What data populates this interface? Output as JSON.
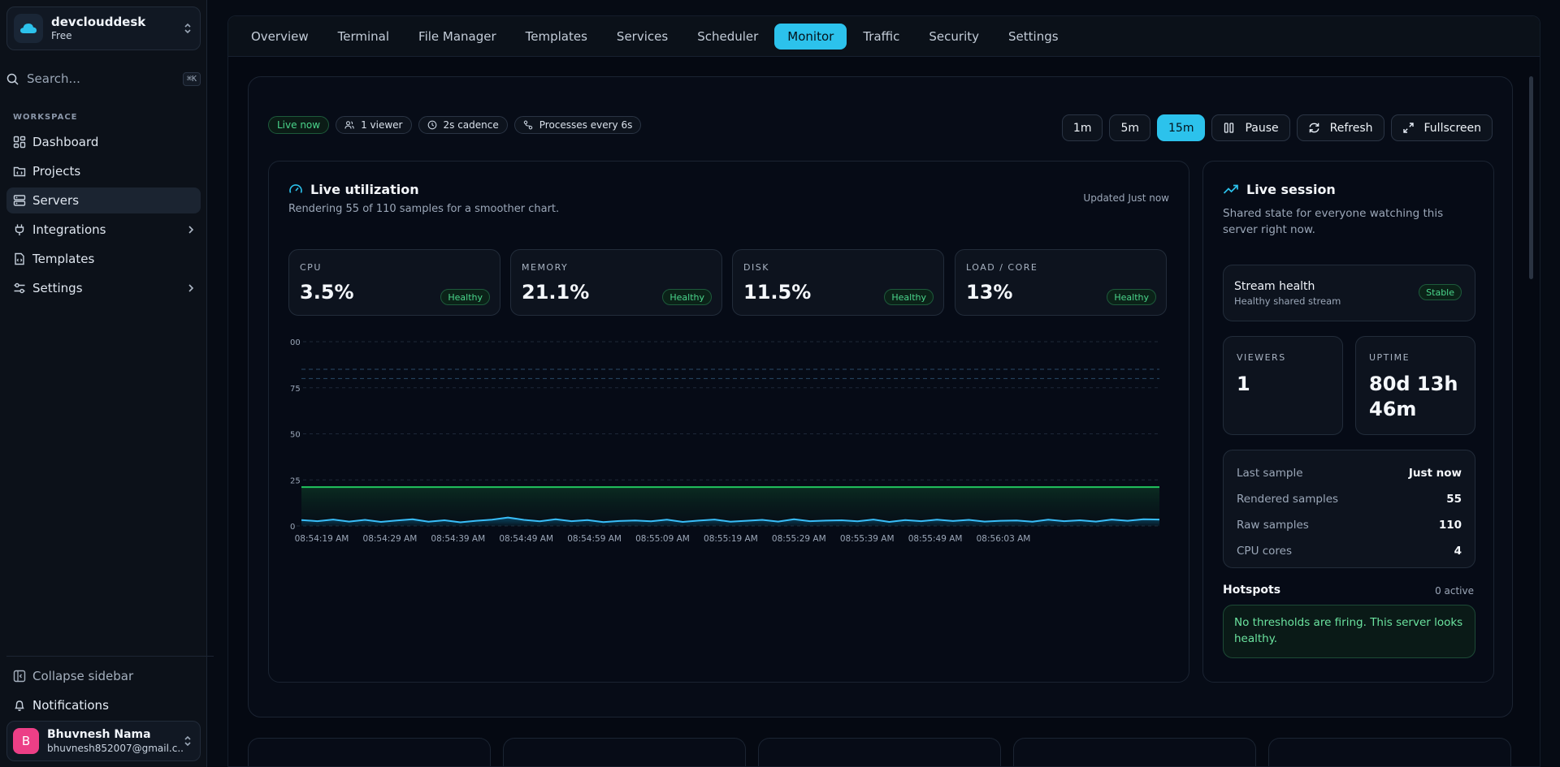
{
  "sidebar": {
    "team": {
      "name": "devclouddesk",
      "plan": "Free"
    },
    "search": {
      "placeholder": "Search...",
      "shortcut": "⌘K"
    },
    "section_label": "WORKSPACE",
    "items": [
      {
        "label": "Dashboard",
        "icon": "dashboard-icon"
      },
      {
        "label": "Projects",
        "icon": "projects-icon"
      },
      {
        "label": "Servers",
        "icon": "servers-icon",
        "active": true
      },
      {
        "label": "Integrations",
        "icon": "plug-icon",
        "has_children": true
      },
      {
        "label": "Templates",
        "icon": "file-code-icon"
      },
      {
        "label": "Settings",
        "icon": "sliders-icon",
        "has_children": true
      }
    ],
    "collapse_label": "Collapse sidebar",
    "notifications_label": "Notifications",
    "user": {
      "initial": "B",
      "name": "Bhuvnesh Nama",
      "email": "bhuvnesh852007@gmail.c..."
    }
  },
  "tabs": [
    "Overview",
    "Terminal",
    "File Manager",
    "Templates",
    "Services",
    "Scheduler",
    "Monitor",
    "Traffic",
    "Security",
    "Settings"
  ],
  "active_tab": "Monitor",
  "status_chips": {
    "live": "Live now",
    "viewers": "1 viewer",
    "cadence": "2s cadence",
    "processes": "Processes every 6s"
  },
  "controls": {
    "ranges": [
      "1m",
      "5m",
      "15m"
    ],
    "active_range": "15m",
    "pause": "Pause",
    "refresh": "Refresh",
    "fullscreen": "Fullscreen"
  },
  "utilization": {
    "title": "Live utilization",
    "subtitle": "Rendering 55 of 110 samples for a smoother chart.",
    "updated": "Updated Just now",
    "metrics": [
      {
        "label": "CPU",
        "value": "3.5%",
        "status": "Healthy"
      },
      {
        "label": "MEMORY",
        "value": "21.1%",
        "status": "Healthy"
      },
      {
        "label": "DISK",
        "value": "11.5%",
        "status": "Healthy"
      },
      {
        "label": "LOAD / CORE",
        "value": "13%",
        "status": "Healthy"
      }
    ]
  },
  "chart_data": {
    "type": "area",
    "ylim": [
      0,
      100
    ],
    "yticks": [
      0,
      25,
      50,
      75,
      100
    ],
    "ytick_labels": [
      "0",
      "25",
      "50",
      "75",
      "00"
    ],
    "reference_lines": [
      80,
      85
    ],
    "x_labels": [
      "08:54:19 AM",
      "08:54:29 AM",
      "08:54:39 AM",
      "08:54:49 AM",
      "08:54:59 AM",
      "08:55:09 AM",
      "08:55:19 AM",
      "08:55:29 AM",
      "08:55:39 AM",
      "08:55:49 AM",
      "08:56:03 AM"
    ],
    "series": [
      {
        "color": "#22c55e",
        "values": [
          21.1,
          21.1,
          21.1,
          21.1,
          21.1,
          21.1,
          21.1,
          21.1,
          21.1,
          21.1,
          21.1,
          21.1,
          21.1,
          21.1,
          21.1,
          21.1,
          21.1,
          21.1,
          21.1,
          21.1,
          21.1,
          21.1,
          21.1,
          21.1,
          21.1,
          21.1,
          21.1,
          21.1,
          21.1,
          21.1,
          21.1,
          21.1,
          21.1,
          21.1,
          21.1,
          21.1,
          21.1,
          21.1,
          21.1,
          21.1,
          21.1,
          21.1,
          21.1,
          21.1,
          21.1,
          21.1,
          21.1,
          21.1,
          21.1,
          21.1,
          21.1,
          21.1,
          21.1,
          21.1,
          21.1
        ]
      },
      {
        "color": "#38bdf8",
        "values": [
          3.2,
          2.6,
          3.5,
          2.4,
          3.3,
          2.2,
          3.0,
          3.6,
          2.3,
          3.1,
          2.0,
          2.8,
          3.4,
          4.6,
          3.3,
          2.5,
          3.6,
          2.6,
          3.2,
          2.1,
          2.7,
          3.0,
          2.5,
          3.4,
          2.2,
          2.9,
          3.5,
          2.3,
          2.8,
          3.3,
          2.4,
          3.6,
          2.6,
          2.9,
          3.1,
          2.5,
          3.5,
          2.2,
          3.2,
          2.6,
          3.4,
          2.7,
          3.3,
          2.4,
          2.8,
          3.0,
          2.3,
          3.4,
          2.6,
          3.1,
          2.4,
          3.5,
          2.8,
          3.6,
          3.5
        ]
      }
    ]
  },
  "session": {
    "title": "Live session",
    "subtitle": "Shared state for everyone watching this server right now.",
    "stream": {
      "title": "Stream health",
      "subtitle": "Healthy shared stream",
      "status": "Stable"
    },
    "viewers": {
      "label": "VIEWERS",
      "value": "1"
    },
    "uptime": {
      "label": "UPTIME",
      "value": "80d 13h 46m"
    },
    "stats": [
      {
        "key": "Last sample",
        "value": "Just now"
      },
      {
        "key": "Rendered samples",
        "value": "55"
      },
      {
        "key": "Raw samples",
        "value": "110"
      },
      {
        "key": "CPU cores",
        "value": "4"
      }
    ],
    "hotspots": {
      "title": "Hotspots",
      "count": "0 active",
      "message": "No thresholds are firing. This server looks healthy."
    }
  },
  "colors": {
    "accent": "#2cc2ec",
    "healthy": "#4ad58b",
    "memory_series": "#22c55e",
    "cpu_series": "#38bdf8"
  }
}
